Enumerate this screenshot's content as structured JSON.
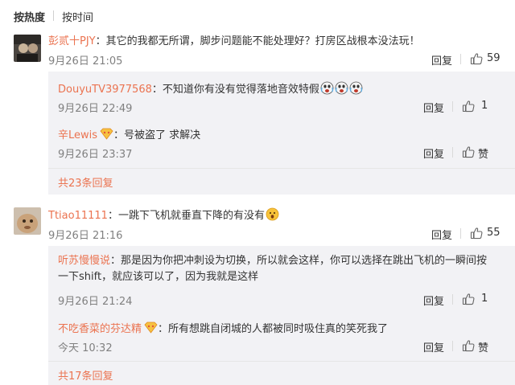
{
  "sort": {
    "hot_label": "按热度",
    "time_label": "按时间"
  },
  "comments": [
    {
      "user": "彭贰十PJY",
      "text": "其它的我都无所谓，脚步问题能不能处理好？打房区战根本没法玩！",
      "date": "9月26日 21:05",
      "reply_label": "回复",
      "likes": "59",
      "replies": [
        {
          "user": "DouyuTV3977568",
          "text": "不知道你有没有觉得落地音效特假",
          "date": "9月26日 22:49",
          "reply_label": "回复",
          "likes": "1"
        },
        {
          "user": "辛Lewis",
          "text": "号被盗了 求解决",
          "date": "9月26日 23:37",
          "reply_label": "回复",
          "likes": "赞"
        }
      ],
      "more_label": "共23条回复"
    },
    {
      "user": "Ttiao11111",
      "text": "一跳下飞机就垂直下降的有没有",
      "date": "9月26日 21:16",
      "reply_label": "回复",
      "likes": "55",
      "replies": [
        {
          "user": "听苏慢慢说",
          "text": "那是因为你把冲刺设为切换，所以就会这样，你可以选择在跳出飞机的一瞬间按一下shift，就应该可以了，因为我就是这样",
          "date": "9月26日 21:24",
          "reply_label": "回复",
          "likes": "1"
        },
        {
          "user": "不吃香菜的芬达精",
          "text": "所有想跳自闭城的人都被同时吸住真的笑死我了",
          "date": "今天 10:32",
          "reply_label": "回复",
          "likes": "赞"
        }
      ],
      "more_label": "共17条回复"
    }
  ],
  "colon": "：",
  "colors": {
    "username": "#eb7350",
    "subbox_bg": "#f2f2f5",
    "date": "#808080"
  },
  "icons": {
    "like": "thumbs-up-icon",
    "laugh": "laugh-cry-emoji",
    "surprise": "surprised-emoji",
    "badge": "vip-badge-icon"
  }
}
